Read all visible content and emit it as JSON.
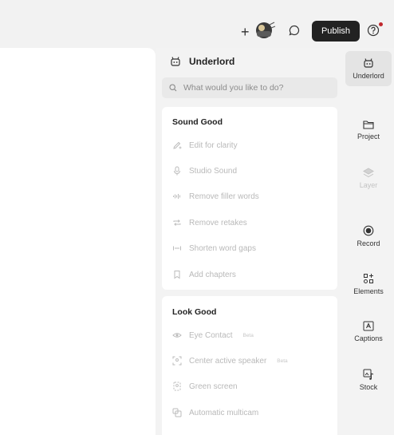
{
  "header": {
    "publish_label": "Publish"
  },
  "panel": {
    "title": "Underlord",
    "search_placeholder": "What would you like to do?",
    "sections": [
      {
        "title": "Sound Good",
        "items": [
          {
            "label": "Edit for clarity",
            "icon": "pencil-sparkle-icon"
          },
          {
            "label": "Studio Sound",
            "icon": "mic-icon"
          },
          {
            "label": "Remove filler words",
            "icon": "waveform-icon"
          },
          {
            "label": "Remove retakes",
            "icon": "repeat-icon"
          },
          {
            "label": "Shorten word gaps",
            "icon": "gap-icon"
          },
          {
            "label": "Add chapters",
            "icon": "bookmark-icon"
          }
        ]
      },
      {
        "title": "Look Good",
        "items": [
          {
            "label": "Eye Contact",
            "badge": "Beta",
            "icon": "eye-icon"
          },
          {
            "label": "Center active speaker",
            "badge": "Beta",
            "icon": "speaker-frame-icon"
          },
          {
            "label": "Green screen",
            "icon": "green-screen-icon"
          },
          {
            "label": "Automatic multicam",
            "icon": "multicam-icon"
          }
        ]
      }
    ]
  },
  "rail": {
    "items": [
      {
        "label": "Underlord",
        "icon": "robot-icon",
        "state": "active"
      },
      {
        "label": "Project",
        "icon": "folder-icon"
      },
      {
        "label": "Layer",
        "icon": "layers-icon",
        "state": "disabled"
      },
      {
        "label": "Record",
        "icon": "record-icon"
      },
      {
        "label": "Elements",
        "icon": "elements-icon"
      },
      {
        "label": "Captions",
        "icon": "captions-icon"
      },
      {
        "label": "Stock",
        "icon": "stock-icon"
      }
    ]
  }
}
